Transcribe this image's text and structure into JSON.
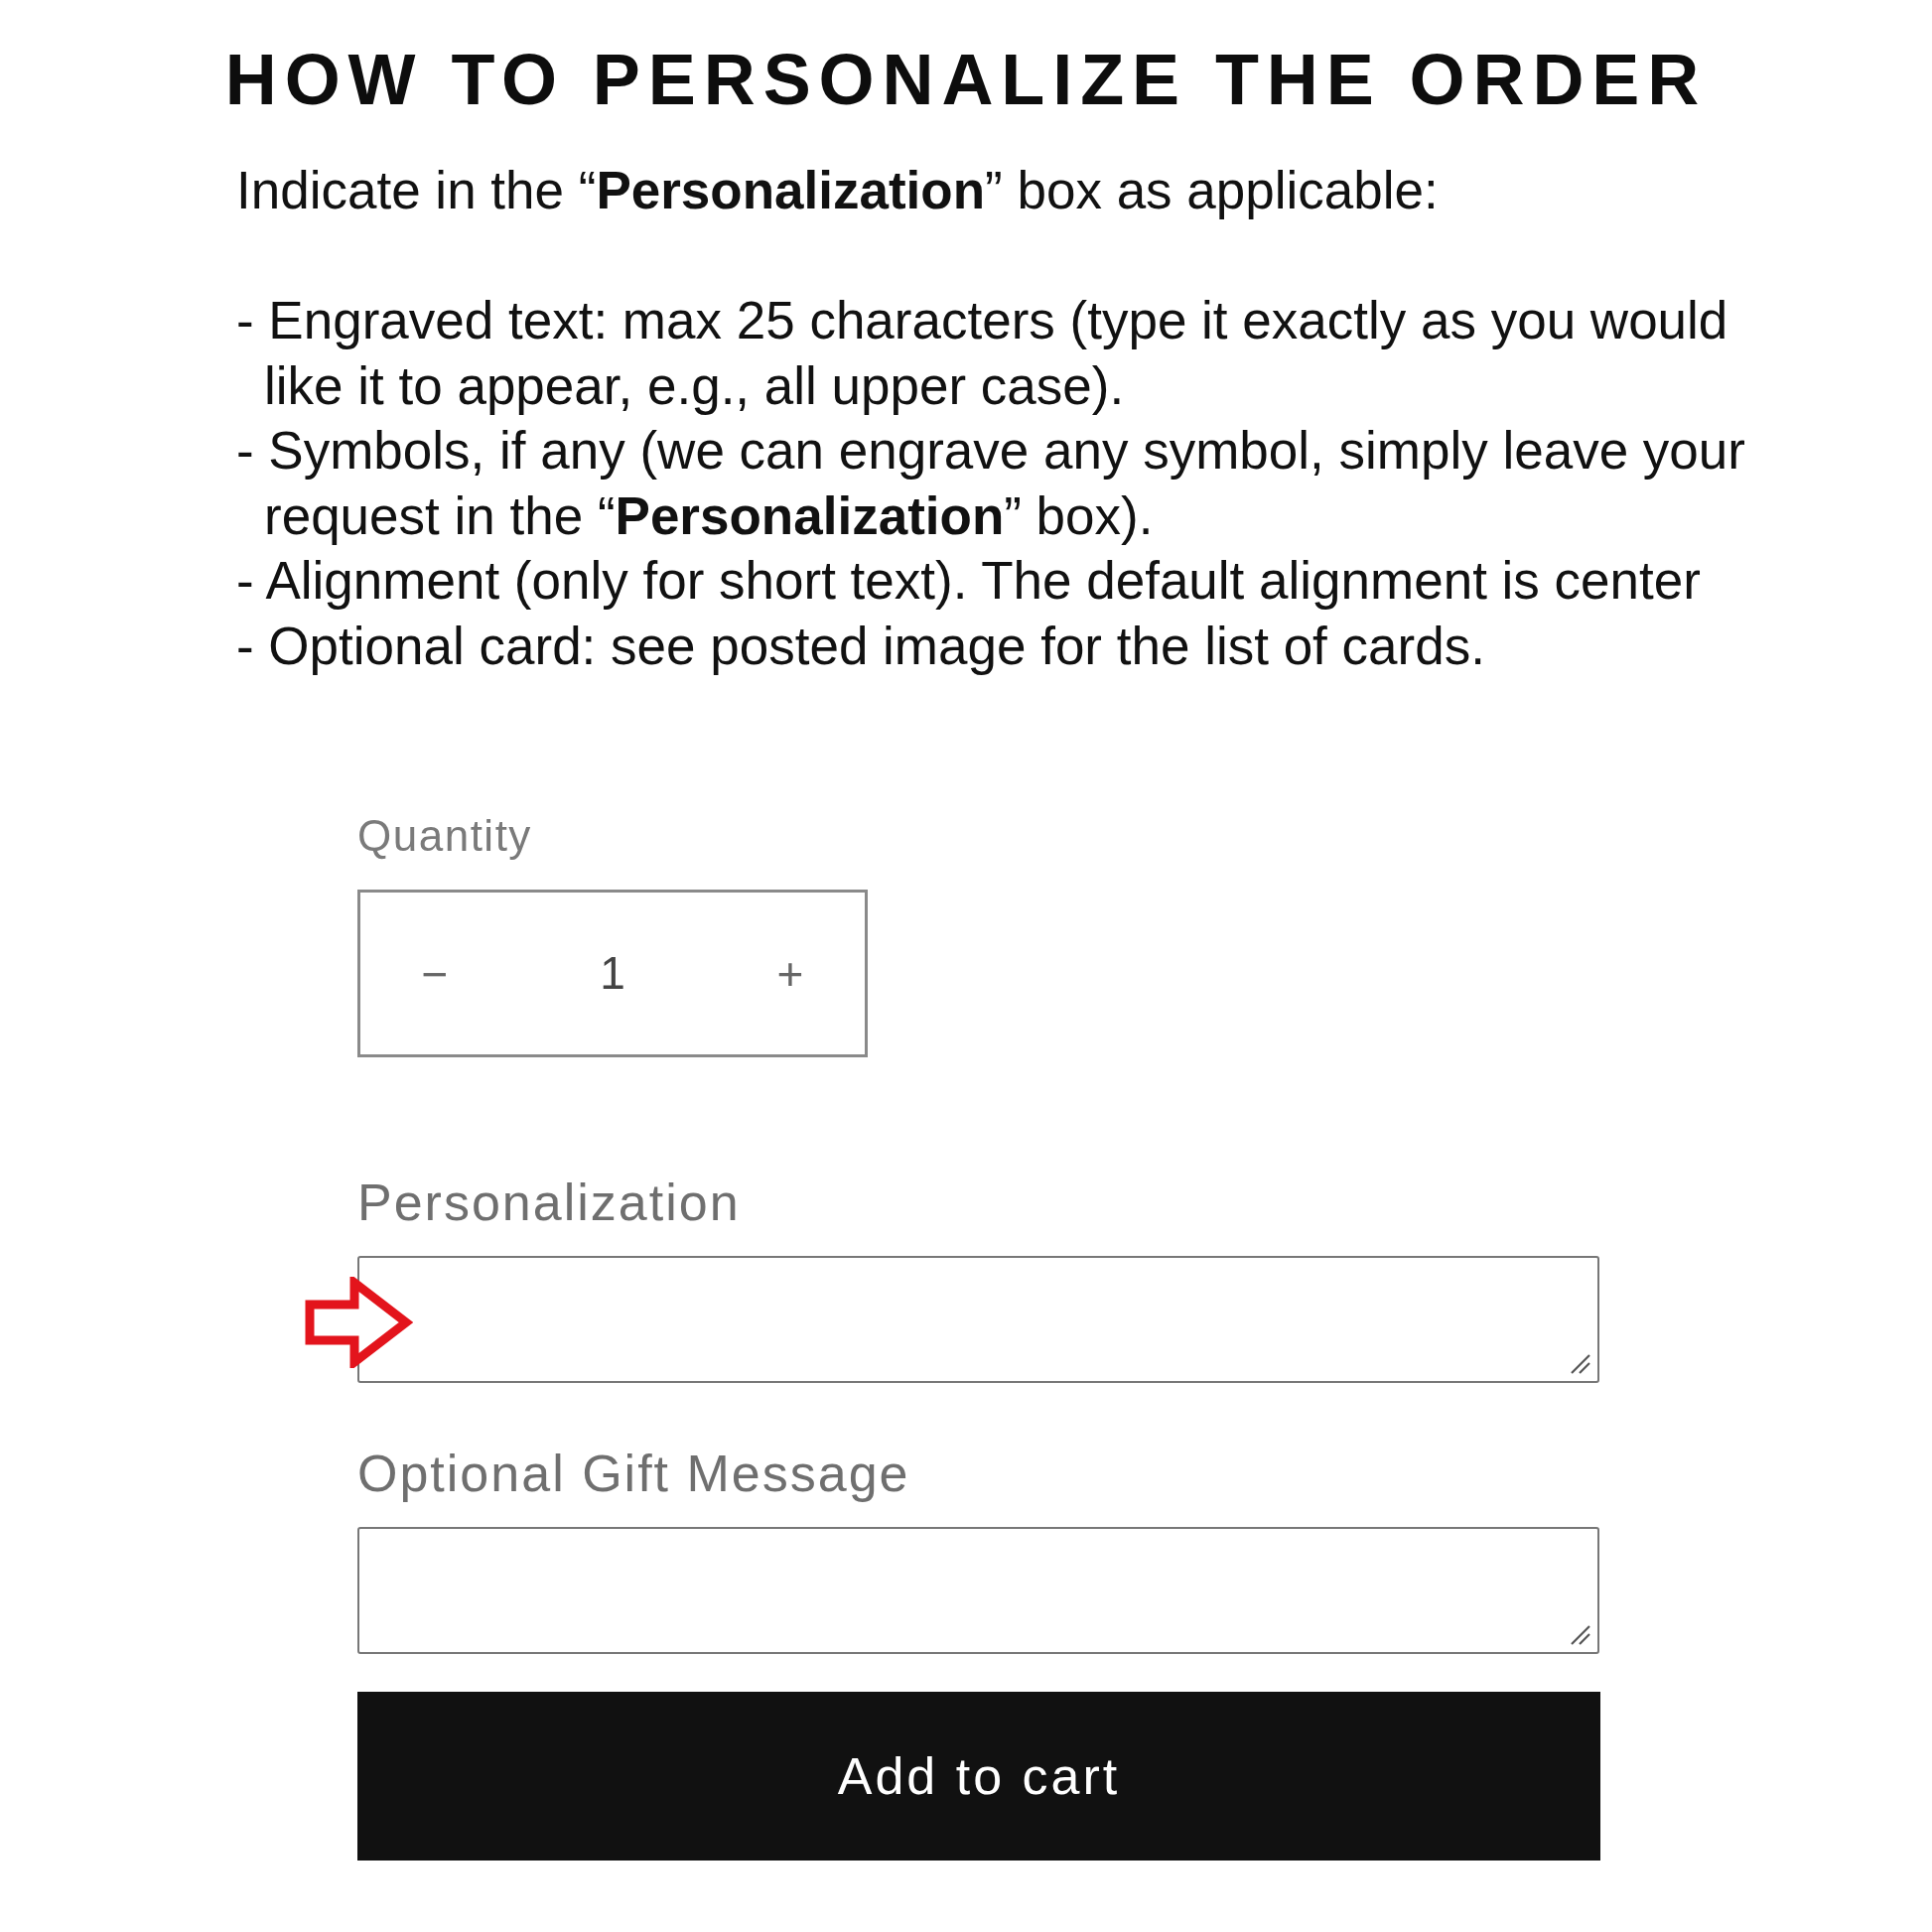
{
  "title": "HOW TO PERSONALIZE THE ORDER",
  "intro": "Indicate in the “**Personalization**” box as applicable:",
  "instructions": [
    "- Engraved text: max 25 characters (type it exactly as you would like it to appear, e.g., all upper case).",
    "- Symbols, if any (we can engrave any symbol, simply leave your request in the “**Personalization**” box).",
    "- Alignment (only for short text). The default alignment is center",
    "- Optional card: see posted image for the list of cards."
  ],
  "form": {
    "quantity": {
      "label": "Quantity",
      "decrement": "−",
      "value": "1",
      "increment": "+"
    },
    "fields": [
      {
        "label": "Personalization",
        "highlighted": true
      },
      {
        "label": "Optional Gift Message",
        "highlighted": false
      }
    ],
    "button": "Add to cart"
  }
}
